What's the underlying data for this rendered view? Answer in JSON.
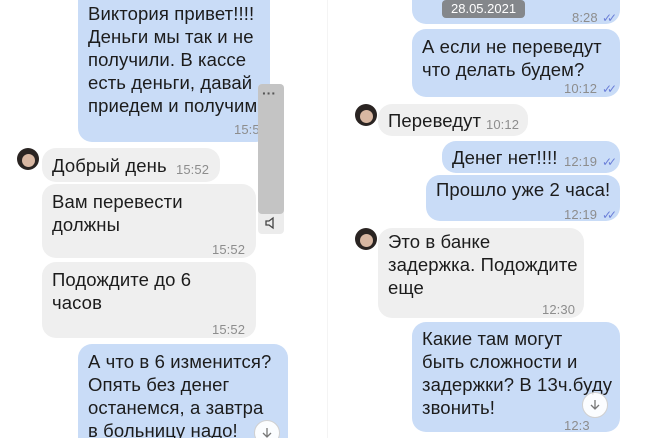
{
  "left": {
    "messages": [
      {
        "type": "out",
        "text": "Виктория привет!!!!\nДеньги  мы  так и не\nполучили.  В кассе\nесть  деньги, давай\nприедем и получим",
        "time": "15:5"
      },
      {
        "type": "in",
        "text": "Добрый день",
        "time": "15:52"
      },
      {
        "type": "in",
        "text": "Вам перевести\nдолжны",
        "time": "15:52"
      },
      {
        "type": "in",
        "text": "Подождите до 6\nчасов",
        "time": "15:52"
      },
      {
        "type": "out",
        "text": "А что в 6 изменится?\nОпять  без денег\nостанемся, а завтра\nв  больницу  надо!",
        "time": ""
      }
    ],
    "voice_icon": "speaker-icon",
    "menu_icon": "more-dots-icon"
  },
  "right": {
    "date_chip": "28.05.2021",
    "messages": [
      {
        "type": "out",
        "text": "",
        "time": "8:28"
      },
      {
        "type": "out",
        "text": "А если  не переведут\nчто делать будем?",
        "time": "10:12"
      },
      {
        "type": "in",
        "text": "Переведут",
        "time": "10:12"
      },
      {
        "type": "out",
        "text": "Денег  нет!!!!",
        "time": "12:19"
      },
      {
        "type": "out",
        "text": "Прошло  уже  2 часа!",
        "time": "12:19"
      },
      {
        "type": "in",
        "text": "Это в банке\nзадержка. Подождите\nеще",
        "time": "12:30"
      },
      {
        "type": "out",
        "text": "Какие там могут\nбыть  сложности и\nзадержки? В 13ч.буду\nзвонить!",
        "time": "12:3"
      }
    ]
  },
  "icons": {
    "read": "double-check-icon",
    "scroll": "scroll-down-icon"
  },
  "colors": {
    "incoming": "#efefef",
    "outgoing": "#c9dcf7",
    "ticks": "#6b7fd8",
    "time": "#8d8d8d"
  }
}
